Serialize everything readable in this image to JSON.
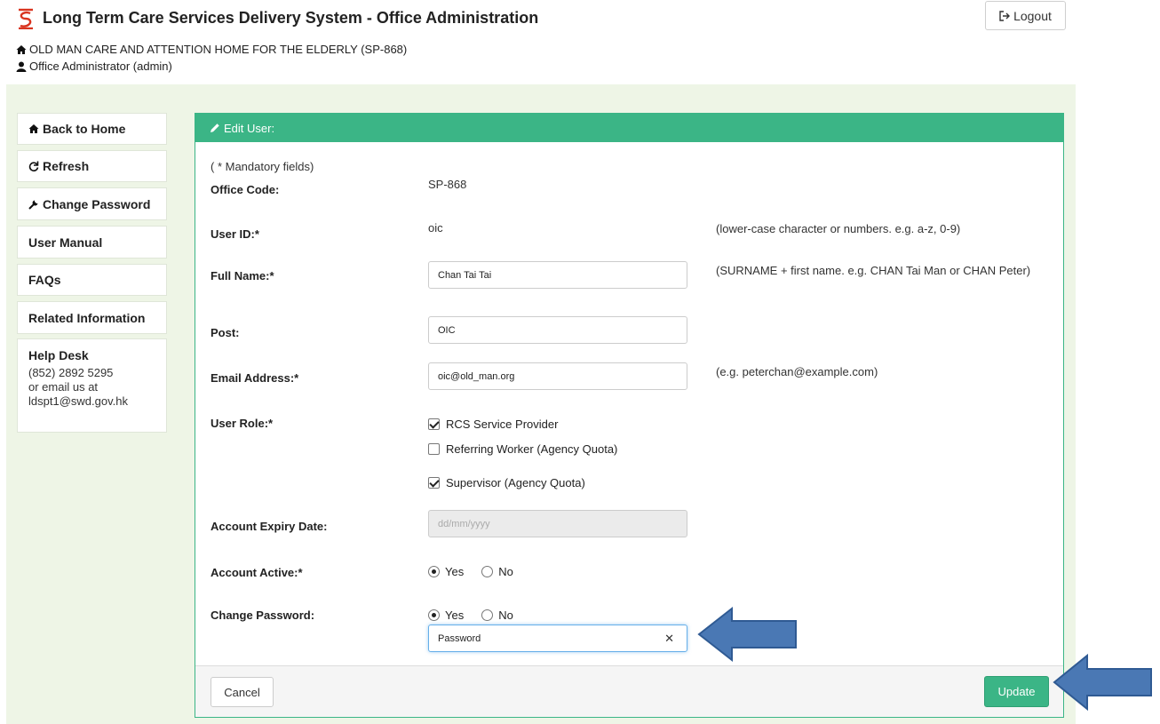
{
  "header": {
    "title": "Long Term Care Services Delivery System - Office Administration",
    "org": "OLD MAN CARE AND ATTENTION HOME FOR THE ELDERLY (SP-868)",
    "user": "Office Administrator (admin)",
    "logout_label": "Logout",
    "brand_color": "#d9341f"
  },
  "sidebar": {
    "items": [
      {
        "label": "Back to Home",
        "icon": "home-icon"
      },
      {
        "label": "Refresh",
        "icon": "refresh-icon"
      },
      {
        "label": "Change Password",
        "icon": "wrench-icon"
      },
      {
        "label": "User Manual"
      },
      {
        "label": "FAQs"
      },
      {
        "label": "Related Information"
      }
    ],
    "helpdesk": {
      "title": "Help Desk",
      "phone": "(852) 2892 5295",
      "email_prefix": "or email us at",
      "email": "ldspt1@swd.gov.hk"
    }
  },
  "panel": {
    "title": "Edit User:",
    "mandatory_note": "( * Mandatory fields)",
    "accent_color": "#3bb586"
  },
  "form": {
    "office_code": {
      "label": "Office Code:",
      "value": "SP-868"
    },
    "user_id": {
      "label": "User ID:*",
      "value": "oic",
      "hint": "(lower-case character or numbers. e.g. a-z, 0-9)"
    },
    "full_name": {
      "label": "Full Name:*",
      "value": "Chan Tai Tai",
      "hint": "(SURNAME + first name. e.g. CHAN Tai Man or CHAN Peter)"
    },
    "post": {
      "label": "Post:",
      "value": "OIC"
    },
    "email": {
      "label": "Email Address:*",
      "value": "oic@old_man.org",
      "hint": "(e.g. peterchan@example.com)"
    },
    "user_role": {
      "label": "User Role:*",
      "options": [
        {
          "label": "RCS Service Provider",
          "checked": true
        },
        {
          "label": "Referring Worker (Agency Quota)",
          "checked": false
        },
        {
          "label": "Supervisor (Agency Quota)",
          "checked": true
        }
      ]
    },
    "expiry": {
      "label": "Account Expiry Date:",
      "placeholder": "dd/mm/yyyy"
    },
    "active": {
      "label": "Account Active:*",
      "yes": "Yes",
      "no": "No",
      "selected": "Yes"
    },
    "change_password": {
      "label": "Change Password:",
      "yes": "Yes",
      "no": "No",
      "selected": "Yes",
      "value": "Password"
    }
  },
  "footer": {
    "cancel_label": "Cancel",
    "update_label": "Update"
  }
}
